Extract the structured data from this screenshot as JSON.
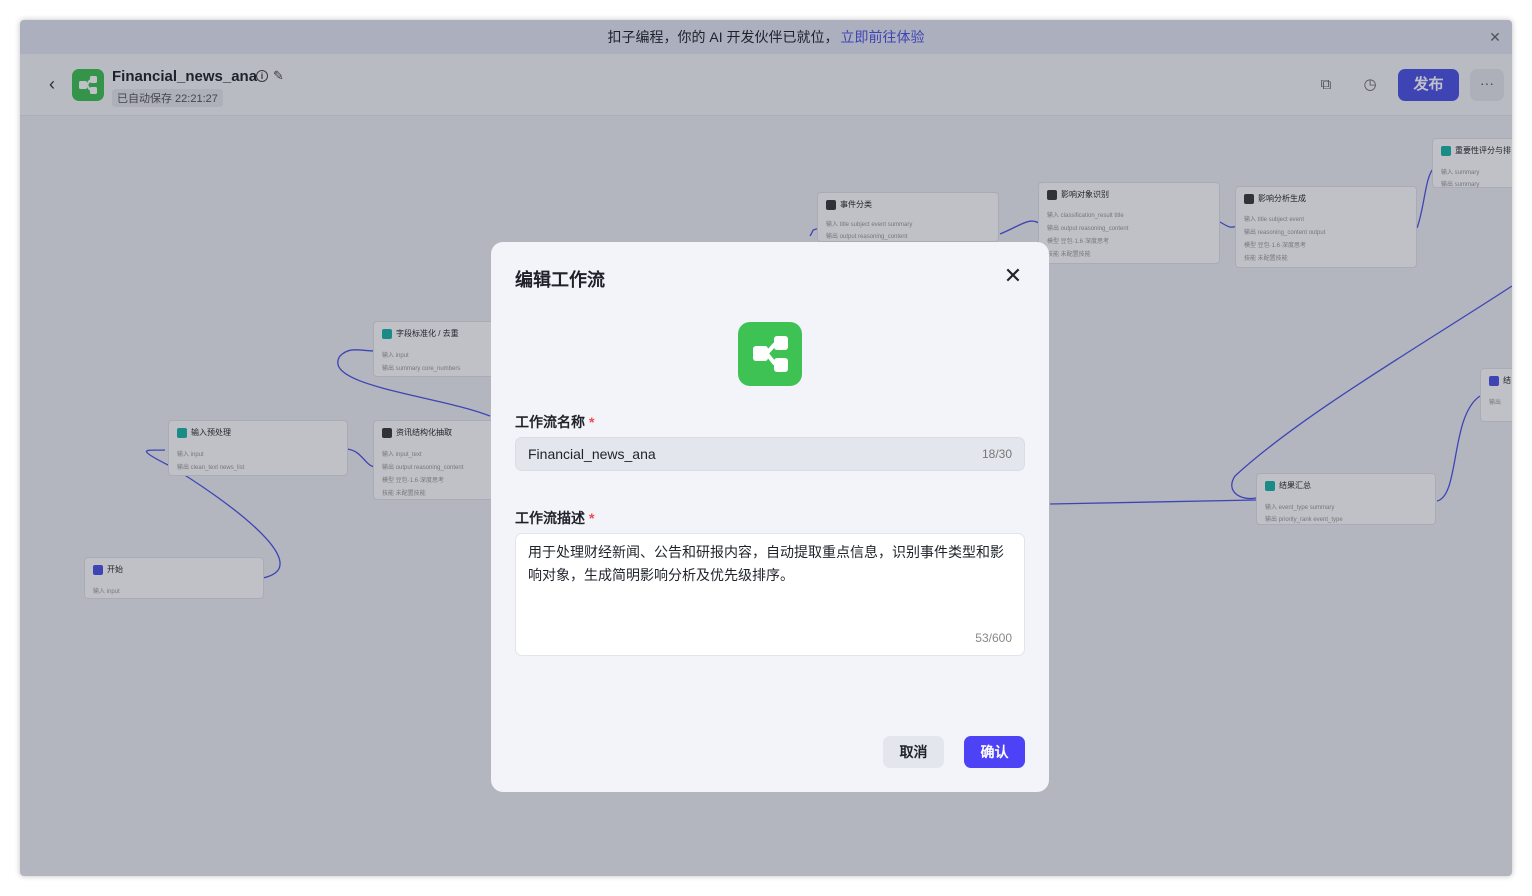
{
  "banner": {
    "text": "扣子编程，你的 AI 开发伙伴已就位，",
    "link": "立即前往体验",
    "close_icon": "close-icon"
  },
  "header": {
    "app_name": "Financial_news_ana",
    "save_status": "已自动保存 22:21:27",
    "info_glyph": "i",
    "publish_label": "发布",
    "more_label": "···"
  },
  "nodes": [
    {
      "title": "开始",
      "rows": [
        "输入  input"
      ]
    },
    {
      "title": "输入预处理",
      "rows": [
        "输入  input",
        "输出  clean_text   news_list"
      ]
    },
    {
      "title": "字段标准化 / 去重",
      "rows": [
        "输入  input",
        "输出  summary   core_numbers"
      ]
    },
    {
      "title": "资讯结构化抽取",
      "rows": [
        "输入  input_text",
        "输出  output   reasoning_content",
        "模型  豆包·1.6·深度思考",
        "技能  未配置技能"
      ]
    },
    {
      "title": "事件分类",
      "rows": [
        "输入  title   subject   event   summary",
        "输出  output   reasoning_content"
      ]
    },
    {
      "title": "影响对象识别",
      "rows": [
        "输入  classification_result   title",
        "输出  output   reasoning_content",
        "模型  豆包·1.6·深度思考",
        "技能  未配置技能"
      ]
    },
    {
      "title": "影响分析生成",
      "rows": [
        "输入  title   subject   event",
        "输出  reasoning_content   output",
        "模型  豆包·1.6·深度思考",
        "技能  未配置技能"
      ]
    },
    {
      "title": "重要性评分与排",
      "rows": [
        "输入  summary",
        "输出  summary"
      ]
    },
    {
      "title": "结果汇总",
      "rows": [
        "输入  event_type   summary",
        "输出  priority_rank   event_type"
      ]
    },
    {
      "title": "结",
      "rows": [
        "输出"
      ]
    }
  ],
  "modal": {
    "title": "编辑工作流",
    "name_label": "工作流名称",
    "required_mark": "*",
    "name_value": "Financial_news_ana",
    "name_count": "18/30",
    "desc_label": "工作流描述",
    "desc_value": "用于处理财经新闻、公告和研报内容，自动提取重点信息，识别事件类型和影响对象，生成简明影响分析及优先级排序。",
    "desc_count": "53/600",
    "cancel_label": "取消",
    "confirm_label": "确认",
    "close_glyph": "✕"
  },
  "colors": {
    "accent": "#4d53e8",
    "confirm": "#4d42f5",
    "app_icon": "#3ec254",
    "required": "#f54a45"
  }
}
